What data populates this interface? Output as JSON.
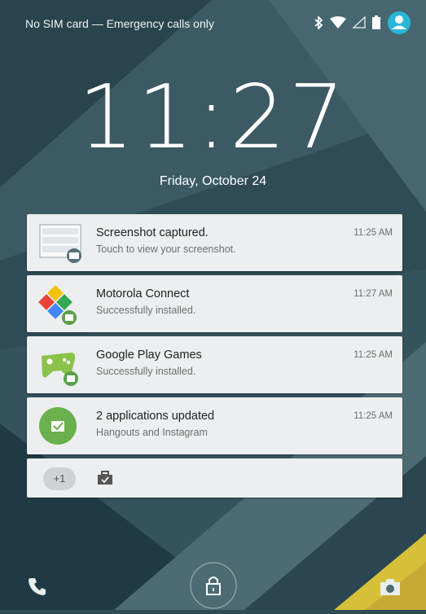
{
  "status_bar": {
    "carrier_text": "No SIM card — Emergency calls only",
    "icons": [
      "bluetooth-icon",
      "wifi-icon",
      "cell-signal-icon",
      "battery-icon",
      "user-icon"
    ]
  },
  "lockscreen": {
    "time": "11:27",
    "date": "Friday, October 24"
  },
  "notifications": [
    {
      "title": "Screenshot captured.",
      "subtitle": "Touch to view your screenshot.",
      "time": "11:25 AM",
      "icon": "screenshot-thumbnail-icon"
    },
    {
      "title": "Motorola Connect",
      "subtitle": "Successfully installed.",
      "time": "11:27 AM",
      "icon": "motorola-connect-icon"
    },
    {
      "title": "Google Play Games",
      "subtitle": "Successfully installed.",
      "time": "11:25 AM",
      "icon": "play-games-icon"
    },
    {
      "title": "2 applications updated",
      "subtitle": "Hangouts and Instagram",
      "time": "11:25 AM",
      "icon": "app-update-icon"
    }
  ],
  "overflow": {
    "count_label": "+1",
    "icon": "briefcase-icon"
  },
  "bottom_actions": {
    "left": "phone-icon",
    "center": "lock-icon",
    "right": "camera-icon"
  },
  "colors": {
    "wallpaper_dark": "#2a4550",
    "wallpaper_light": "#4f7079",
    "accent_teal": "#29b6d8",
    "card_background": "#eceeef",
    "update_green": "#6ab04c"
  }
}
